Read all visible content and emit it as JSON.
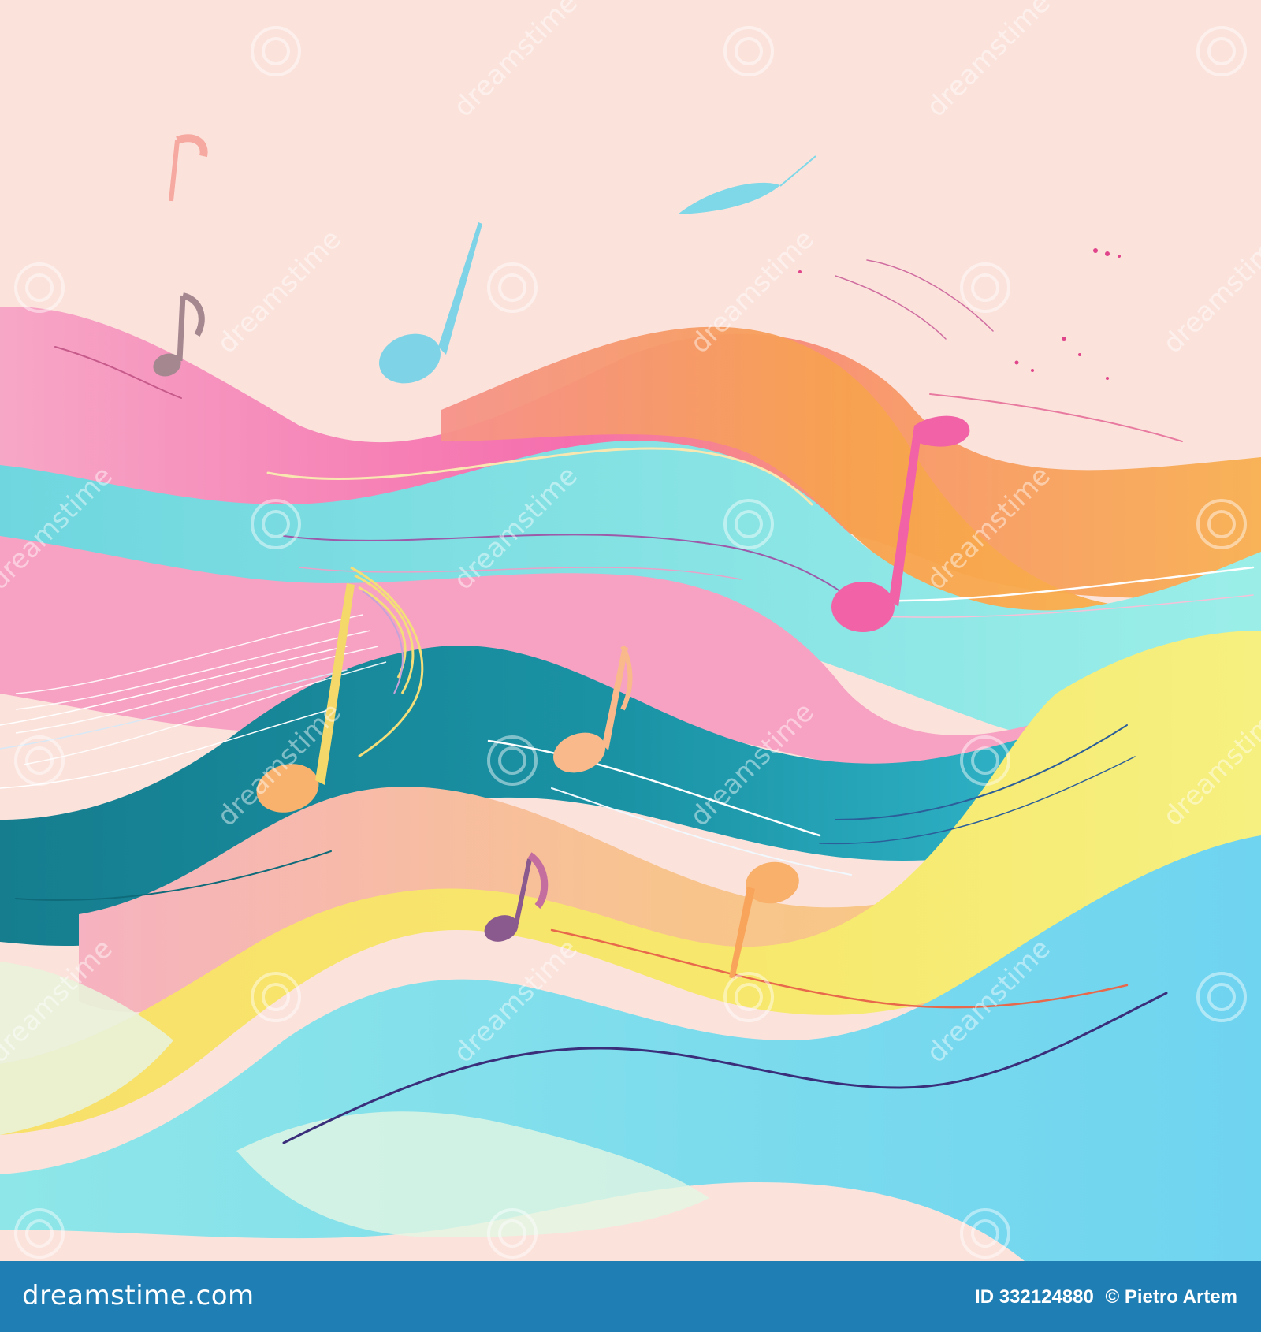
{
  "artwork": {
    "subject_colors": {
      "background": "#fbe3dc",
      "pink": "#f58fb8",
      "orange": "#f7a04f",
      "cyan": "#7ee3e6",
      "teal": "#1b8fa0",
      "yellow": "#f8e46a",
      "sky": "#7fd8ee"
    }
  },
  "watermark": {
    "text": "dreamstime",
    "color": "#ffffff"
  },
  "footer": {
    "brand": "dreamstime.com",
    "image_id": "ID 332124880",
    "author": "© Pietro Artem",
    "bar_color": "#1f7fb5"
  }
}
